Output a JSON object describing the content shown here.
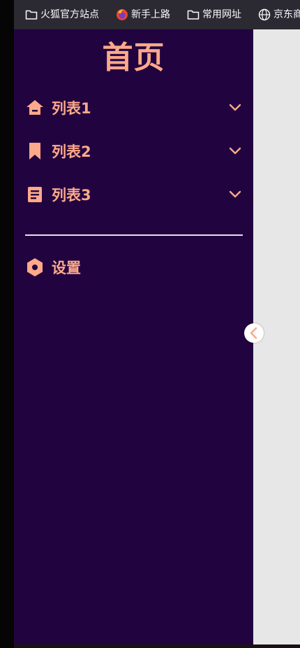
{
  "browser": {
    "bookmarks": [
      {
        "label": "火狐官方站点",
        "icon": "folder-icon"
      },
      {
        "label": "新手上路",
        "icon": "firefox-icon"
      },
      {
        "label": "常用网址",
        "icon": "folder-icon"
      },
      {
        "label": "京东商",
        "icon": "globe-icon"
      }
    ]
  },
  "sidebar": {
    "title": "首页",
    "items": [
      {
        "label": "列表1",
        "icon": "home-icon",
        "expandable": true
      },
      {
        "label": "列表2",
        "icon": "bookmark-icon",
        "expandable": true
      },
      {
        "label": "列表3",
        "icon": "document-icon",
        "expandable": true
      }
    ],
    "settings": {
      "label": "设置",
      "icon": "hexagon-settings-icon"
    }
  },
  "colors": {
    "sidebar_bg": "#21033f",
    "accent": "#ffa98a",
    "main_bg": "#e8e7e8",
    "toolbar_bg": "#2b2a33"
  }
}
